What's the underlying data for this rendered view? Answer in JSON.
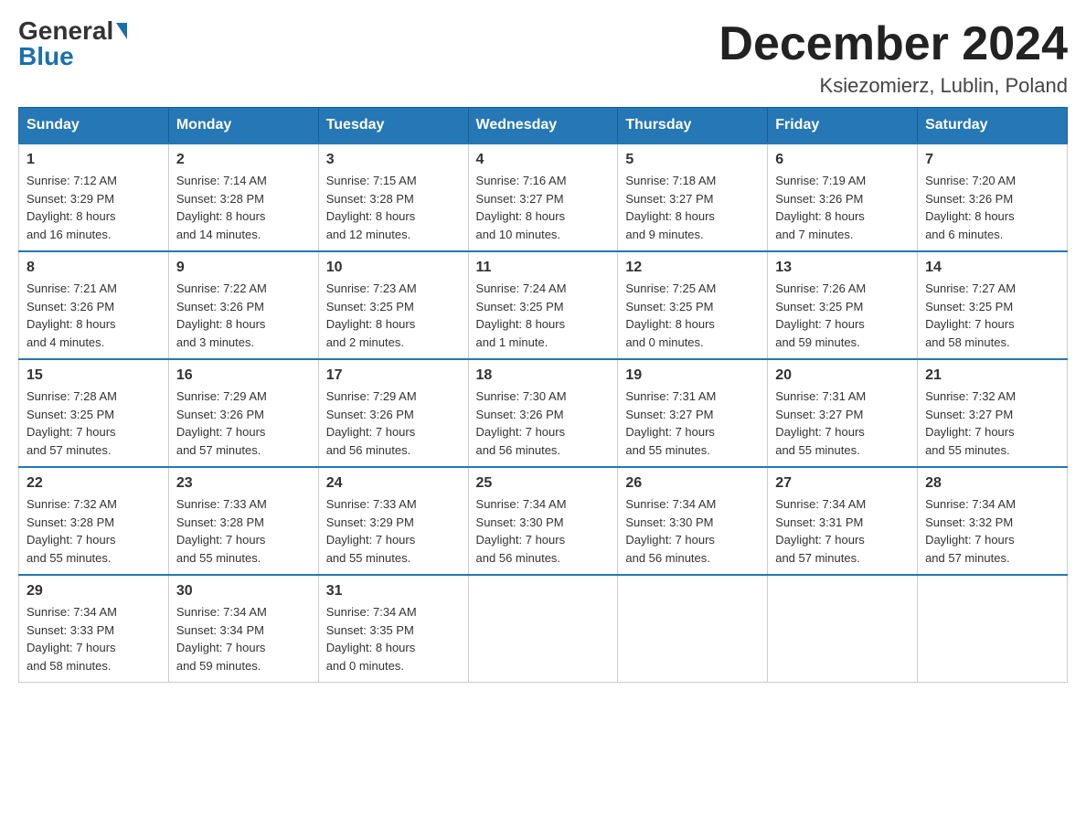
{
  "logo": {
    "general": "General",
    "blue": "Blue"
  },
  "title": "December 2024",
  "subtitle": "Ksiezomierz, Lublin, Poland",
  "days_of_week": [
    "Sunday",
    "Monday",
    "Tuesday",
    "Wednesday",
    "Thursday",
    "Friday",
    "Saturday"
  ],
  "weeks": [
    [
      {
        "day": "1",
        "sunrise": "7:12 AM",
        "sunset": "3:29 PM",
        "daylight": "8 hours and 16 minutes."
      },
      {
        "day": "2",
        "sunrise": "7:14 AM",
        "sunset": "3:28 PM",
        "daylight": "8 hours and 14 minutes."
      },
      {
        "day": "3",
        "sunrise": "7:15 AM",
        "sunset": "3:28 PM",
        "daylight": "8 hours and 12 minutes."
      },
      {
        "day": "4",
        "sunrise": "7:16 AM",
        "sunset": "3:27 PM",
        "daylight": "8 hours and 10 minutes."
      },
      {
        "day": "5",
        "sunrise": "7:18 AM",
        "sunset": "3:27 PM",
        "daylight": "8 hours and 9 minutes."
      },
      {
        "day": "6",
        "sunrise": "7:19 AM",
        "sunset": "3:26 PM",
        "daylight": "8 hours and 7 minutes."
      },
      {
        "day": "7",
        "sunrise": "7:20 AM",
        "sunset": "3:26 PM",
        "daylight": "8 hours and 6 minutes."
      }
    ],
    [
      {
        "day": "8",
        "sunrise": "7:21 AM",
        "sunset": "3:26 PM",
        "daylight": "8 hours and 4 minutes."
      },
      {
        "day": "9",
        "sunrise": "7:22 AM",
        "sunset": "3:26 PM",
        "daylight": "8 hours and 3 minutes."
      },
      {
        "day": "10",
        "sunrise": "7:23 AM",
        "sunset": "3:25 PM",
        "daylight": "8 hours and 2 minutes."
      },
      {
        "day": "11",
        "sunrise": "7:24 AM",
        "sunset": "3:25 PM",
        "daylight": "8 hours and 1 minute."
      },
      {
        "day": "12",
        "sunrise": "7:25 AM",
        "sunset": "3:25 PM",
        "daylight": "8 hours and 0 minutes."
      },
      {
        "day": "13",
        "sunrise": "7:26 AM",
        "sunset": "3:25 PM",
        "daylight": "7 hours and 59 minutes."
      },
      {
        "day": "14",
        "sunrise": "7:27 AM",
        "sunset": "3:25 PM",
        "daylight": "7 hours and 58 minutes."
      }
    ],
    [
      {
        "day": "15",
        "sunrise": "7:28 AM",
        "sunset": "3:25 PM",
        "daylight": "7 hours and 57 minutes."
      },
      {
        "day": "16",
        "sunrise": "7:29 AM",
        "sunset": "3:26 PM",
        "daylight": "7 hours and 57 minutes."
      },
      {
        "day": "17",
        "sunrise": "7:29 AM",
        "sunset": "3:26 PM",
        "daylight": "7 hours and 56 minutes."
      },
      {
        "day": "18",
        "sunrise": "7:30 AM",
        "sunset": "3:26 PM",
        "daylight": "7 hours and 56 minutes."
      },
      {
        "day": "19",
        "sunrise": "7:31 AM",
        "sunset": "3:27 PM",
        "daylight": "7 hours and 55 minutes."
      },
      {
        "day": "20",
        "sunrise": "7:31 AM",
        "sunset": "3:27 PM",
        "daylight": "7 hours and 55 minutes."
      },
      {
        "day": "21",
        "sunrise": "7:32 AM",
        "sunset": "3:27 PM",
        "daylight": "7 hours and 55 minutes."
      }
    ],
    [
      {
        "day": "22",
        "sunrise": "7:32 AM",
        "sunset": "3:28 PM",
        "daylight": "7 hours and 55 minutes."
      },
      {
        "day": "23",
        "sunrise": "7:33 AM",
        "sunset": "3:28 PM",
        "daylight": "7 hours and 55 minutes."
      },
      {
        "day": "24",
        "sunrise": "7:33 AM",
        "sunset": "3:29 PM",
        "daylight": "7 hours and 55 minutes."
      },
      {
        "day": "25",
        "sunrise": "7:34 AM",
        "sunset": "3:30 PM",
        "daylight": "7 hours and 56 minutes."
      },
      {
        "day": "26",
        "sunrise": "7:34 AM",
        "sunset": "3:30 PM",
        "daylight": "7 hours and 56 minutes."
      },
      {
        "day": "27",
        "sunrise": "7:34 AM",
        "sunset": "3:31 PM",
        "daylight": "7 hours and 57 minutes."
      },
      {
        "day": "28",
        "sunrise": "7:34 AM",
        "sunset": "3:32 PM",
        "daylight": "7 hours and 57 minutes."
      }
    ],
    [
      {
        "day": "29",
        "sunrise": "7:34 AM",
        "sunset": "3:33 PM",
        "daylight": "7 hours and 58 minutes."
      },
      {
        "day": "30",
        "sunrise": "7:34 AM",
        "sunset": "3:34 PM",
        "daylight": "7 hours and 59 minutes."
      },
      {
        "day": "31",
        "sunrise": "7:34 AM",
        "sunset": "3:35 PM",
        "daylight": "8 hours and 0 minutes."
      },
      null,
      null,
      null,
      null
    ]
  ],
  "labels": {
    "sunrise": "Sunrise:",
    "sunset": "Sunset:",
    "daylight": "Daylight:"
  }
}
